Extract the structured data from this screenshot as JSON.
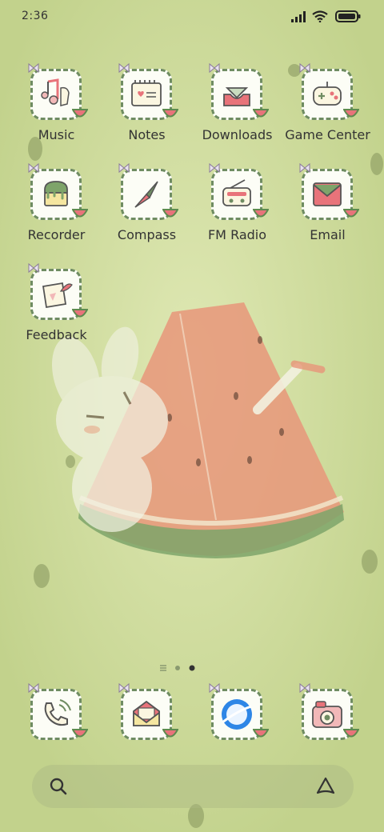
{
  "status_bar": {
    "time": "2:36"
  },
  "apps": [
    {
      "label": "Music",
      "icon": "music-note-icon"
    },
    {
      "label": "Notes",
      "icon": "notepad-heart-icon"
    },
    {
      "label": "Downloads",
      "icon": "download-tray-icon"
    },
    {
      "label": "Game Center",
      "icon": "gamepad-icon"
    },
    {
      "label": "Recorder",
      "icon": "cake-recorder-icon"
    },
    {
      "label": "Compass",
      "icon": "compass-needle-icon"
    },
    {
      "label": "FM Radio",
      "icon": "radio-icon"
    },
    {
      "label": "Email",
      "icon": "envelope-icon"
    },
    {
      "label": "Feedback",
      "icon": "feedback-paper-icon"
    }
  ],
  "dock": [
    {
      "icon": "phone-icon"
    },
    {
      "icon": "message-envelope-icon"
    },
    {
      "icon": "browser-planet-icon"
    },
    {
      "icon": "camera-icon"
    }
  ],
  "page_indicator": {
    "pages": 2,
    "current": 2
  },
  "colors": {
    "tile_border": "#6f8c62",
    "accent_pink": "#e8737a",
    "wallpaper": "#cfdc9a"
  }
}
